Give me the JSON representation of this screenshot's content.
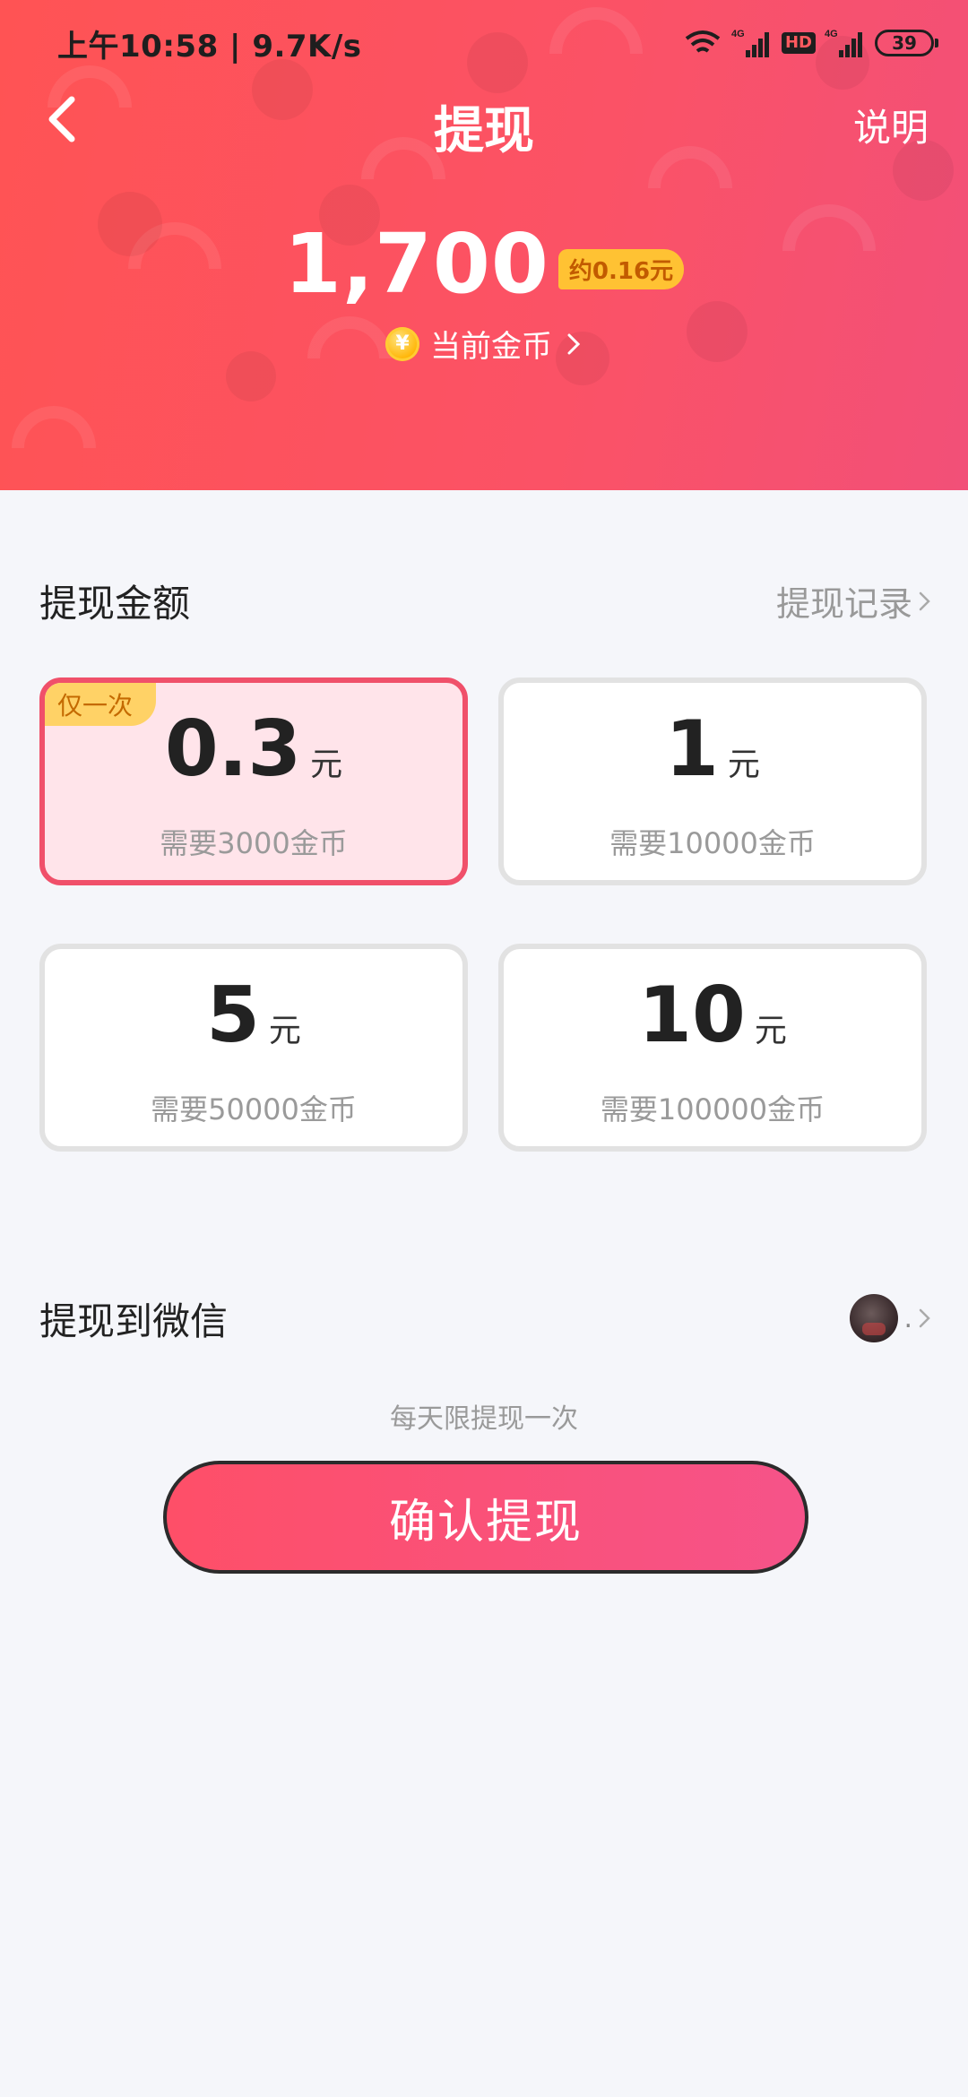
{
  "status_bar": {
    "time_speed": "上午10:58 | 9.7K/s",
    "signal_label": "4G",
    "hd_label": "HD",
    "battery": "39"
  },
  "header": {
    "title": "提现",
    "right_link": "说明"
  },
  "balance": {
    "value": "1,700",
    "approx": "约0.16元",
    "coin_symbol": "¥",
    "label": "当前金币"
  },
  "withdraw_section": {
    "title": "提现金额",
    "records_link": "提现记录"
  },
  "options": [
    {
      "tag": "仅一次",
      "amount": "0.3",
      "unit": "元",
      "need": "需要3000金币",
      "selected": true
    },
    {
      "tag": "",
      "amount": "1",
      "unit": "元",
      "need": "需要10000金币",
      "selected": false
    },
    {
      "tag": "",
      "amount": "5",
      "unit": "元",
      "need": "需要50000金币",
      "selected": false
    },
    {
      "tag": "",
      "amount": "10",
      "unit": "元",
      "need": "需要100000金币",
      "selected": false
    }
  ],
  "wechat": {
    "label": "提现到微信",
    "name": "."
  },
  "daily_note": "每天限提现一次",
  "confirm_button": "确认提现",
  "colors": {
    "brand_red": "#fe4f68",
    "brand_pink": "#f65389",
    "badge_yellow": "#ffc233",
    "selected_border": "#f0506a"
  }
}
